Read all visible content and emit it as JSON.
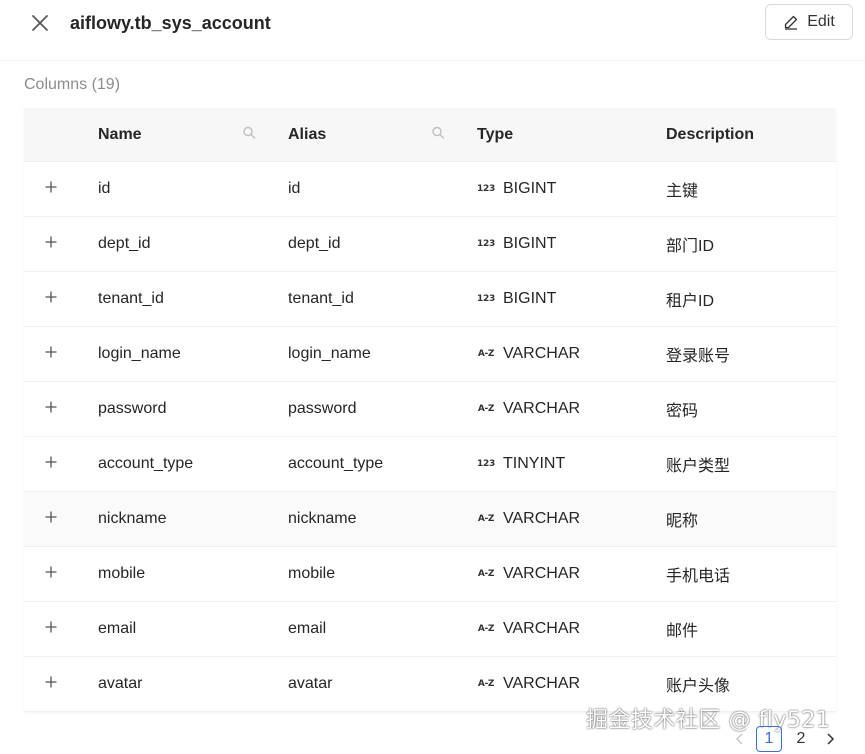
{
  "header": {
    "title": "aiflowy.tb_sys_account",
    "edit_label": "Edit"
  },
  "section": {
    "label": "Columns (19)"
  },
  "table": {
    "headers": {
      "name": "Name",
      "alias": "Alias",
      "type": "Type",
      "description": "Description"
    },
    "rows": [
      {
        "name": "id",
        "alias": "id",
        "type_icon": "123",
        "type": "BIGINT",
        "description": "主键"
      },
      {
        "name": "dept_id",
        "alias": "dept_id",
        "type_icon": "123",
        "type": "BIGINT",
        "description": "部门ID"
      },
      {
        "name": "tenant_id",
        "alias": "tenant_id",
        "type_icon": "123",
        "type": "BIGINT",
        "description": "租户ID"
      },
      {
        "name": "login_name",
        "alias": "login_name",
        "type_icon": "A-Z",
        "type": "VARCHAR",
        "description": "登录账号"
      },
      {
        "name": "password",
        "alias": "password",
        "type_icon": "A-Z",
        "type": "VARCHAR",
        "description": "密码"
      },
      {
        "name": "account_type",
        "alias": "account_type",
        "type_icon": "123",
        "type": "TINYINT",
        "description": "账户类型"
      },
      {
        "name": "nickname",
        "alias": "nickname",
        "type_icon": "A-Z",
        "type": "VARCHAR",
        "description": "昵称"
      },
      {
        "name": "mobile",
        "alias": "mobile",
        "type_icon": "A-Z",
        "type": "VARCHAR",
        "description": "手机电话"
      },
      {
        "name": "email",
        "alias": "email",
        "type_icon": "A-Z",
        "type": "VARCHAR",
        "description": "邮件"
      },
      {
        "name": "avatar",
        "alias": "avatar",
        "type_icon": "A-Z",
        "type": "VARCHAR",
        "description": "账户头像"
      }
    ]
  },
  "pagination": {
    "pages": [
      "1",
      "2"
    ],
    "current": "1"
  },
  "watermark": "掘金技术社区 @ fly521",
  "colors": {
    "accent": "#3b6fd8",
    "header_bg": "#f7f7f8",
    "border": "#f0f0f0",
    "muted_text": "#8c8c8c"
  }
}
